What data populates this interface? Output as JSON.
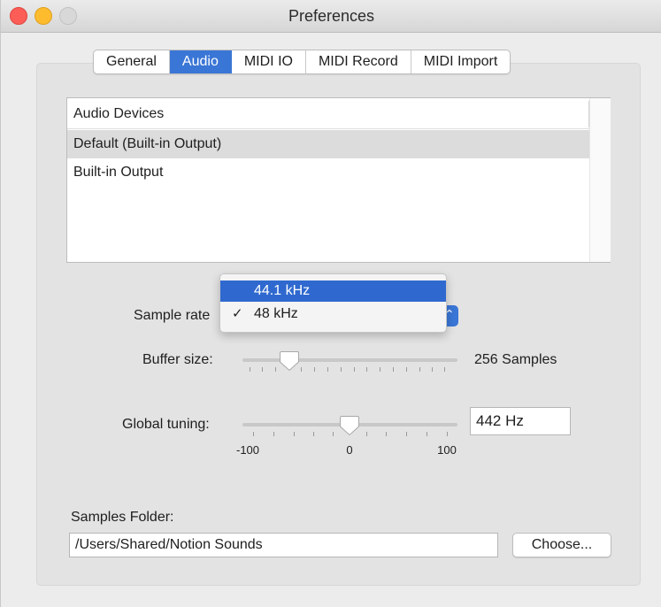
{
  "window": {
    "title": "Preferences"
  },
  "tabs": [
    {
      "label": "General",
      "active": false
    },
    {
      "label": "Audio",
      "active": true
    },
    {
      "label": "MIDI IO",
      "active": false
    },
    {
      "label": "MIDI Record",
      "active": false
    },
    {
      "label": "MIDI Import",
      "active": false
    }
  ],
  "devices": {
    "header": "Audio Devices",
    "items": [
      {
        "label": "Default (Built-in Output)",
        "selected": true
      },
      {
        "label": "Built-in Output",
        "selected": false
      }
    ]
  },
  "sample_rate": {
    "label": "Sample rate",
    "options": [
      {
        "label": "44.1 kHz",
        "highlighted": true,
        "checked": false
      },
      {
        "label": "48 kHz",
        "highlighted": false,
        "checked": true
      }
    ],
    "check_glyph": "✓"
  },
  "buffer": {
    "label": "Buffer size:",
    "value_text": "256 Samples"
  },
  "tuning": {
    "label": "Global tuning:",
    "value": "442 Hz",
    "min_label": "-100",
    "mid_label": "0",
    "max_label": "100"
  },
  "samples_folder": {
    "label": "Samples Folder:",
    "path": "/Users/Shared/Notion Sounds",
    "choose_label": "Choose..."
  },
  "colors": {
    "accent": "#3a76d6",
    "menu_highlight": "#2f69cf",
    "close": "#fc5d57",
    "minimize": "#fdbc2e",
    "zoom_disabled": "#d8d8d8"
  },
  "icons": {
    "popup": "up-down-chevron-icon"
  }
}
